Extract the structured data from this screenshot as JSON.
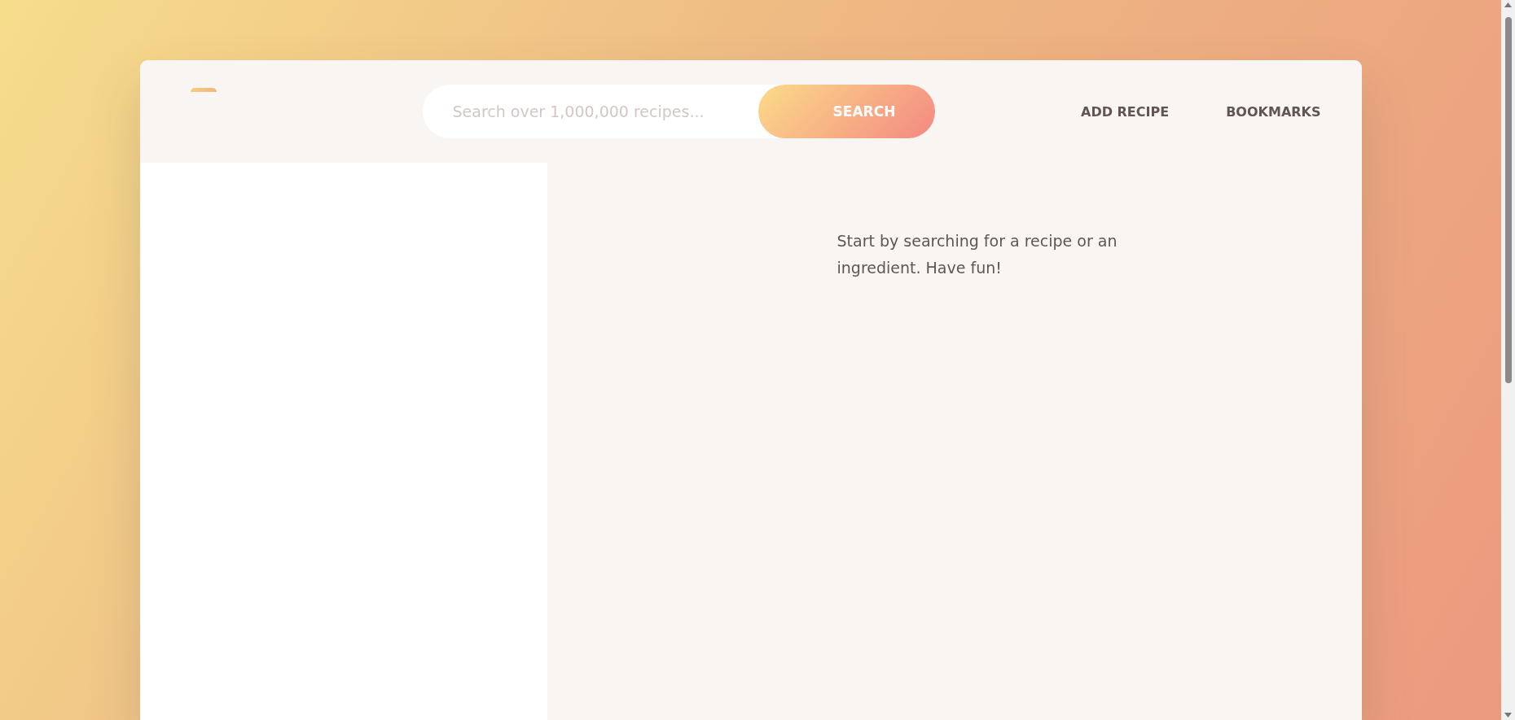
{
  "search": {
    "placeholder": "Search over 1,000,000 recipes...",
    "button": "SEARCH"
  },
  "nav": [
    {
      "label": "ADD RECIPE"
    },
    {
      "label": "BOOKMARKS"
    }
  ],
  "message": "Start by searching for a recipe or an ingredient. Have fun!"
}
